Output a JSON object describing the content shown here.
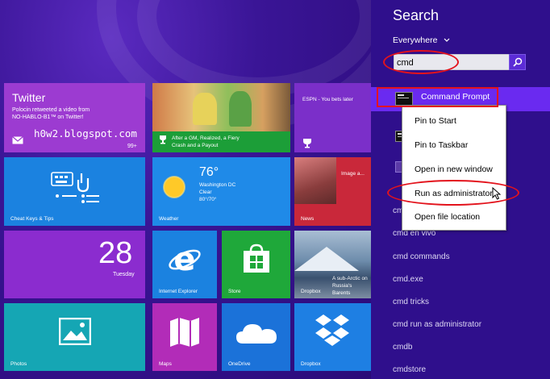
{
  "tiles": {
    "twitter": {
      "title": "Twitter",
      "line1": "Polocin retweeted a video from",
      "line2": "NO-HABLO-B1™ on Twitter!",
      "count": "99+"
    },
    "money": {
      "headline_line1": "After a GM, Realized, a Fiery",
      "headline_line2": "Crash and a Payout"
    },
    "sports": {
      "headline": "ESPN - You bets later"
    },
    "cheat": {
      "label": "Cheat Keys & Tips"
    },
    "weather": {
      "temp": "76°",
      "city": "Washington DC",
      "condition": "Clear",
      "range": "80°/70°",
      "label": "Weather"
    },
    "news": {
      "headline": "Image a...",
      "label": "News"
    },
    "calendar": {
      "day_number": "28",
      "day_name": "Tuesday"
    },
    "ie": {
      "label": "Internet Explorer"
    },
    "store": {
      "label": "Store"
    },
    "travel": {
      "line1": "A sub-Arctic on",
      "line2": "Russia's Barents",
      "label": "Dropbox"
    },
    "photos": {
      "label": "Photos"
    },
    "maps": {
      "label": "Maps"
    },
    "onedrive": {
      "label": "OneDrive"
    },
    "dropbox": {
      "label": "Dropbox"
    }
  },
  "watermark": "h0w2.blogspot.com",
  "search": {
    "title": "Search",
    "scope": "Everywhere",
    "query": "cmd",
    "top_result": "Command Prompt",
    "suggestions": [
      "cmd",
      "cmd en vivo",
      "cmd commands",
      "cmd.exe",
      "cmd tricks",
      "cmd run as administrator",
      "cmdb",
      "cmdstore"
    ]
  },
  "context_menu": {
    "items": [
      "Pin to Start",
      "Pin to Taskbar",
      "Open in new window",
      "Run as administrator",
      "Open file location"
    ]
  },
  "colors": {
    "annotation": "#e3131c",
    "pane": "#2f0f8c",
    "highlight": "#6a2af0"
  }
}
